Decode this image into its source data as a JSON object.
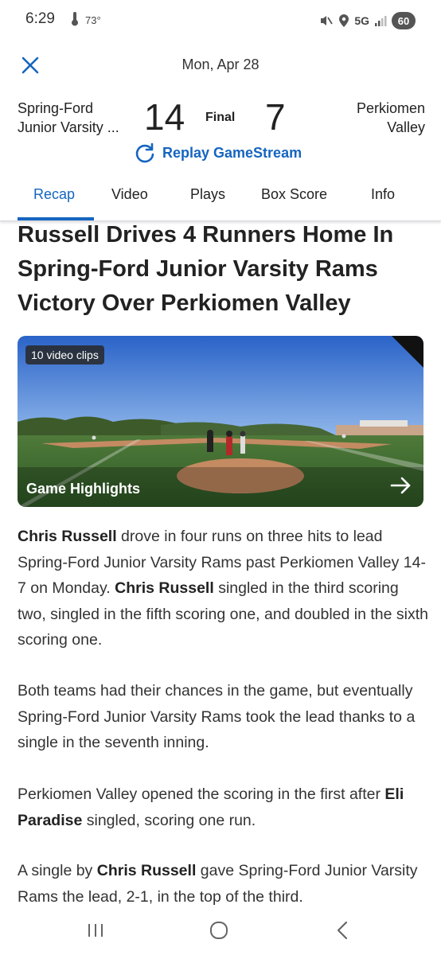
{
  "status_bar": {
    "time": "6:29",
    "temperature": "73°",
    "network": "5G",
    "battery": "60"
  },
  "header": {
    "date": "Mon, Apr 28",
    "home_team_line1": "Spring-Ford",
    "home_team_line2": "Junior Varsity ...",
    "home_score": "14",
    "status": "Final",
    "away_score": "7",
    "away_team_line1": "Perkiomen",
    "away_team_line2": "Valley",
    "replay_label": "Replay GameStream"
  },
  "tabs": [
    {
      "label": "Recap",
      "active": true
    },
    {
      "label": "Video",
      "active": false
    },
    {
      "label": "Plays",
      "active": false
    },
    {
      "label": "Box Score",
      "active": false
    },
    {
      "label": "Info",
      "active": false
    }
  ],
  "article": {
    "headline": "Russell Drives 4 Runners Home In Spring-Ford Junior Varsity Rams Victory Over Perkiomen Valley",
    "video": {
      "clips_badge": "10 video clips",
      "label": "Game Highlights"
    },
    "p1": {
      "name1": "Chris Russell",
      "text1": " drove in four runs on three hits to lead Spring-Ford Junior Varsity Rams past Perkiomen Valley 14-7 on Monday. ",
      "name2": "Chris Russell",
      "text2": " singled in the third scoring two, singled in the fifth scoring one, and doubled in the sixth scoring one."
    },
    "p2": "Both teams had their chances in the game, but eventually Spring-Ford Junior Varsity Rams took the lead thanks to a single in the seventh inning.",
    "p3": {
      "text1": "Perkiomen Valley opened the scoring in the first after ",
      "name": "Eli Paradise",
      "text2": " singled, scoring one run."
    },
    "p4": {
      "text1": "A single by ",
      "name": "Chris Russell",
      "text2": " gave Spring-Ford Junior Varsity Rams the lead, 2-1, in the top of the third."
    }
  },
  "colors": {
    "accent": "#1565c0",
    "text": "#222222"
  },
  "icons": {
    "close": "close-icon",
    "replay": "replay-icon",
    "arrow": "arrow-right-icon",
    "nav_recents": "recents-icon",
    "nav_home": "home-icon",
    "nav_back": "back-icon"
  }
}
